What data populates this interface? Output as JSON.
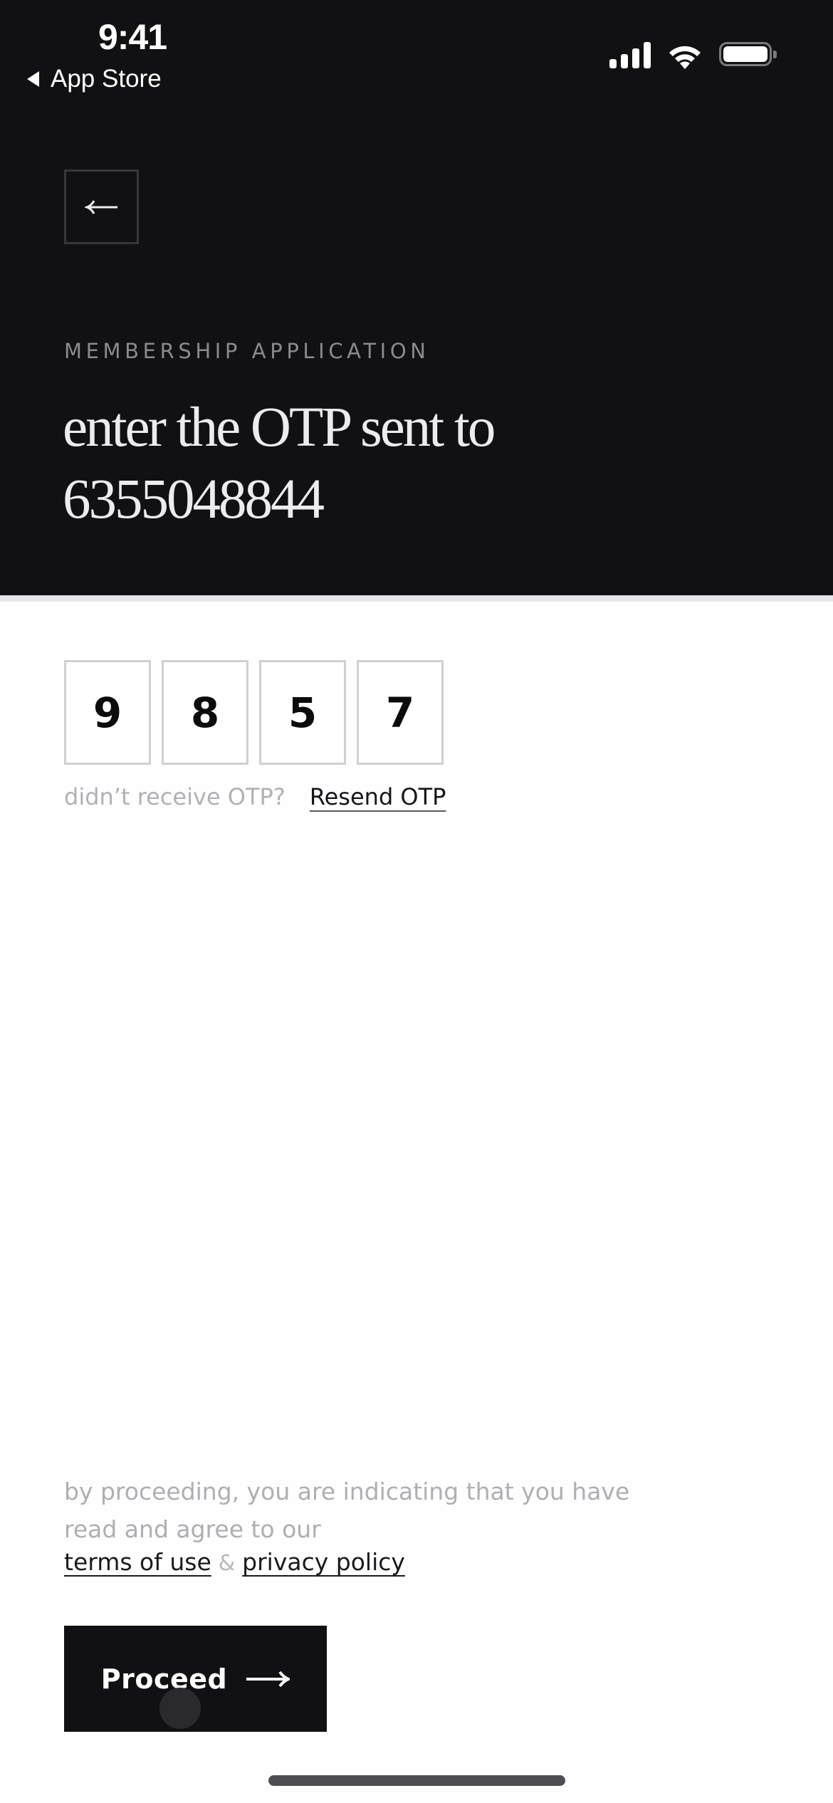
{
  "status_bar": {
    "time": "9:41",
    "back_app_label": "App Store",
    "icons": [
      "cellular-signal-icon",
      "wifi-icon",
      "battery-icon"
    ]
  },
  "header": {
    "back_icon": "arrow-left-icon",
    "eyebrow": "MEMBERSHIP APPLICATION",
    "title_line1": "enter the OTP sent to",
    "title_line2": "6355048844"
  },
  "otp": {
    "digits": [
      "9",
      "8",
      "5",
      "7"
    ],
    "resend_prompt": "didn’t receive OTP?",
    "resend_label": "Resend OTP"
  },
  "footer": {
    "disclaimer_line1": "by proceeding, you are indicating that you have",
    "disclaimer_line2": "read and agree to our",
    "terms_label": "terms of use",
    "ampersand": "&",
    "privacy_label": "privacy policy",
    "proceed_label": "Proceed",
    "proceed_icon": "arrow-right-icon"
  },
  "colors": {
    "header_bg": "#111013",
    "page_bg": "#fefefe",
    "muted_text": "#afaeb3",
    "box_border": "#d0cfd2"
  }
}
